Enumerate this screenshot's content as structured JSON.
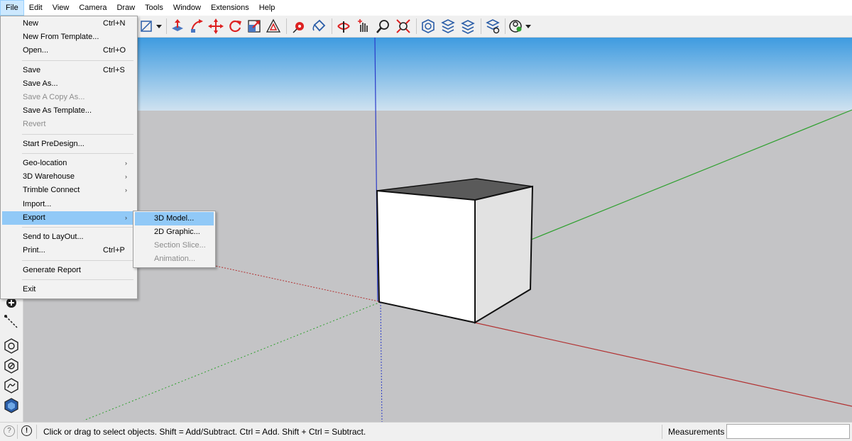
{
  "menubar": {
    "items": [
      "File",
      "Edit",
      "View",
      "Camera",
      "Draw",
      "Tools",
      "Window",
      "Extensions",
      "Help"
    ]
  },
  "file_menu": {
    "items": [
      {
        "label": "New",
        "shortcut": "Ctrl+N"
      },
      {
        "label": "New From Template...",
        "shortcut": ""
      },
      {
        "label": "Open...",
        "shortcut": "Ctrl+O"
      },
      {
        "label": "Save",
        "shortcut": "Ctrl+S"
      },
      {
        "label": "Save As...",
        "shortcut": ""
      },
      {
        "label": "Save A Copy As...",
        "shortcut": ""
      },
      {
        "label": "Save As Template...",
        "shortcut": ""
      },
      {
        "label": "Revert",
        "shortcut": ""
      },
      {
        "label": "Start PreDesign...",
        "shortcut": ""
      },
      {
        "label": "Geo-location",
        "shortcut": ""
      },
      {
        "label": "3D Warehouse",
        "shortcut": ""
      },
      {
        "label": "Trimble Connect",
        "shortcut": ""
      },
      {
        "label": "Import...",
        "shortcut": ""
      },
      {
        "label": "Export",
        "shortcut": ""
      },
      {
        "label": "Send to LayOut...",
        "shortcut": ""
      },
      {
        "label": "Print...",
        "shortcut": "Ctrl+P"
      },
      {
        "label": "Generate Report",
        "shortcut": ""
      },
      {
        "label": "Exit",
        "shortcut": ""
      }
    ],
    "submenu_arrow": "›"
  },
  "export_menu": {
    "items": [
      {
        "label": "3D Model..."
      },
      {
        "label": "2D Graphic..."
      },
      {
        "label": "Section Slice..."
      },
      {
        "label": "Animation..."
      }
    ]
  },
  "statusbar": {
    "message": "Click or drag to select objects. Shift = Add/Subtract. Ctrl = Add. Shift + Ctrl = Subtract.",
    "measurements_label": "Measurements",
    "measurements_value": ""
  },
  "toolbar": {
    "icons": [
      "line-dropdown-icon",
      "push-pull-icon",
      "follow-me-icon",
      "move-icon",
      "rotate-icon",
      "scale-icon",
      "offset-icon",
      "tape-measure-icon",
      "paint-bucket-icon",
      "orbit-icon",
      "pan-icon",
      "zoom-icon",
      "zoom-extents-icon",
      "3d-warehouse-icon",
      "extension-warehouse-icon",
      "layout-icon",
      "extension-manager-icon",
      "account-icon"
    ]
  },
  "left_toolbar": {
    "icons": [
      "position-camera-icon",
      "walk-icon",
      "section-plane-icon",
      "solid-tools-icon",
      "sandbox-icon",
      "styles-icon"
    ]
  },
  "colors": {
    "sky_top": "#3e9be0",
    "sky_bottom": "#cfe2f0",
    "ground": "#c4c4c6",
    "axis_red": "#b23030",
    "axis_green": "#2ea02e",
    "axis_blue": "#2b3bc9",
    "menu_highlight": "#91c9f7"
  }
}
